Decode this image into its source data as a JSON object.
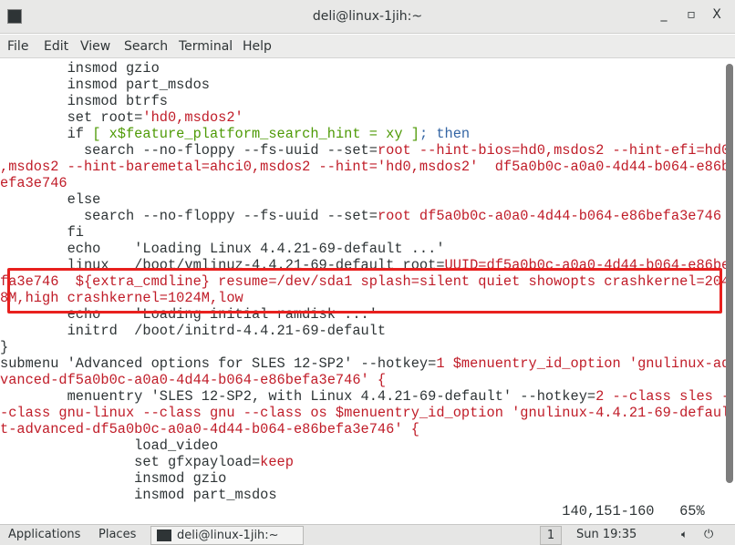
{
  "window": {
    "title": "deli@linux-1jih:~",
    "minimize": "_",
    "maximize": "▫",
    "close": "X"
  },
  "menubar": [
    "File",
    "Edit",
    "View",
    "Search",
    "Terminal",
    "Help"
  ],
  "terminal": {
    "lines": [
      [
        [
          "k",
          "        insmod gzio"
        ]
      ],
      [
        [
          "k",
          "        insmod part_msdos"
        ]
      ],
      [
        [
          "k",
          "        insmod btrfs"
        ]
      ],
      [
        [
          "k",
          "        set root="
        ],
        [
          "r",
          "'hd0,msdos2'"
        ]
      ],
      [
        [
          "k",
          "        if "
        ],
        [
          "g",
          "[ x$feature_platform_search_hint = xy ]"
        ],
        [
          "b",
          "; then"
        ]
      ],
      [
        [
          "k",
          "          search --no-floppy --fs-uuid --set="
        ],
        [
          "r",
          "root --hint-bios=hd0,msdos2 --hint-efi=hd0"
        ]
      ],
      [
        [
          "r",
          ",msdos2 --hint-baremetal=ahci0,msdos2 --hint='hd0,msdos2'  df5a0b0c-a0a0-4d44-b064-e86b"
        ]
      ],
      [
        [
          "r",
          "efa3e746"
        ]
      ],
      [
        [
          "k",
          "        else"
        ]
      ],
      [
        [
          "k",
          "          search --no-floppy --fs-uuid --set="
        ],
        [
          "r",
          "root df5a0b0c-a0a0-4d44-b064-e86befa3e746"
        ]
      ],
      [
        [
          "k",
          "        fi"
        ]
      ],
      [
        [
          "k",
          "        echo    'Loading Linux 4.4.21-69-default ...'"
        ]
      ],
      [
        [
          "k",
          "        linux   /boot/vmlinuz-4.4.21-69-default root="
        ],
        [
          "r",
          "UUID=df5a0b0c-a0a0-4d44-b064-e86be"
        ]
      ],
      [
        [
          "r",
          "fa3e746  ${extra_cmdline} resume=/dev/sda1 splash=silent quiet showopts crashkernel=204"
        ]
      ],
      [
        [
          "r",
          "8M,high crashkernel=1024M,low"
        ]
      ],
      [
        [
          "k",
          "        echo    'Loading initial ramdisk ...'"
        ]
      ],
      [
        [
          "k",
          "        initrd  /boot/initrd-4.4.21-69-default"
        ]
      ],
      [
        [
          "k",
          "}"
        ]
      ],
      [
        [
          "k",
          "submenu 'Advanced options for SLES 12-SP2' --hotkey="
        ],
        [
          "r",
          "1 $menuentry_id_option 'gnulinux-ad"
        ]
      ],
      [
        [
          "r",
          "vanced-df5a0b0c-a0a0-4d44-b064-e86befa3e746' {"
        ]
      ],
      [
        [
          "k",
          "        menuentry 'SLES 12-SP2, with Linux 4.4.21-69-default' --hotkey="
        ],
        [
          "r",
          "2 --class sles -"
        ]
      ],
      [
        [
          "r",
          "-class gnu-linux --class gnu --class os $menuentry_id_option 'gnulinux-4.4.21-69-defaul"
        ]
      ],
      [
        [
          "r",
          "t-advanced-df5a0b0c-a0a0-4d44-b064-e86befa3e746' {"
        ]
      ],
      [
        [
          "k",
          "                load_video"
        ]
      ],
      [
        [
          "k",
          "                set gfxpayload="
        ],
        [
          "r",
          "keep"
        ]
      ],
      [
        [
          "k",
          "                insmod gzio"
        ]
      ],
      [
        [
          "k",
          "                insmod part_msdos"
        ]
      ]
    ],
    "status": "                                                                   140,151-160   65%",
    "highlight_color": "#e8201e"
  },
  "taskbar": {
    "applications": "Applications",
    "places": "Places",
    "task": "deli@linux-1jih:~",
    "workspace": "1",
    "clock": "Sun 19:35",
    "volume_icon": "speaker-icon",
    "power_icon": "power-icon"
  }
}
